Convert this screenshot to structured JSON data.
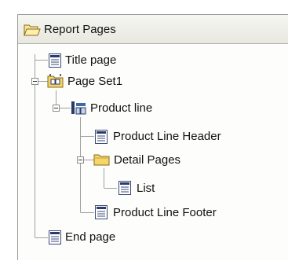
{
  "panel": {
    "title": "Report Pages",
    "title_icon": "folder-open-icon"
  },
  "tree": {
    "title_page": "Title page",
    "page_set": "Page Set1",
    "product_line": "Product line",
    "product_line_header": "Product Line Header",
    "detail_pages": "Detail Pages",
    "list": "List",
    "product_line_footer": "Product Line Footer",
    "end_page": "End page"
  },
  "colors": {
    "folder": "#f5d66a",
    "page_icon": "#3a4a7a",
    "connector": "#a0a0a0"
  }
}
